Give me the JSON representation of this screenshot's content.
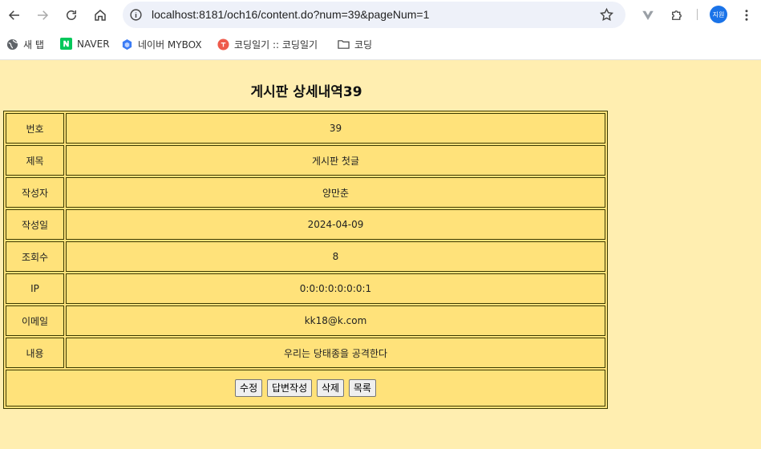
{
  "browser": {
    "url": "localhost:8181/och16/content.do?num=39&pageNum=1",
    "avatar_label": "지원",
    "bookmarks": [
      {
        "label": "새 탭",
        "icon": "globe-icon"
      },
      {
        "label": "NAVER",
        "icon": "naver-icon"
      },
      {
        "label": "네이버 MYBOX",
        "icon": "mybox-icon"
      },
      {
        "label": "코딩일기 :: 코딩일기",
        "icon": "blog-icon"
      },
      {
        "label": "코딩",
        "icon": "folder-icon"
      }
    ]
  },
  "page": {
    "title": "게시판 상세내역39",
    "fields": {
      "num": {
        "label": "번호",
        "value": "39"
      },
      "subject": {
        "label": "제목",
        "value": "게시판 첫글"
      },
      "writer": {
        "label": "작성자",
        "value": "양만춘"
      },
      "date": {
        "label": "작성일",
        "value": "2024-04-09"
      },
      "views": {
        "label": "조회수",
        "value": "8"
      },
      "ip": {
        "label": "IP",
        "value": "0:0:0:0:0:0:0:1"
      },
      "email": {
        "label": "이메일",
        "value": "kk18@k.com"
      },
      "content": {
        "label": "내용",
        "value": "우리는 당태종을 공격한다"
      }
    },
    "buttons": {
      "edit": "수정",
      "reply": "답변작성",
      "delete": "삭제",
      "list": "목록"
    }
  },
  "colors": {
    "page_bg": "#ffeeb0",
    "cell_bg": "#ffe27a",
    "border": "#3a3a00"
  }
}
